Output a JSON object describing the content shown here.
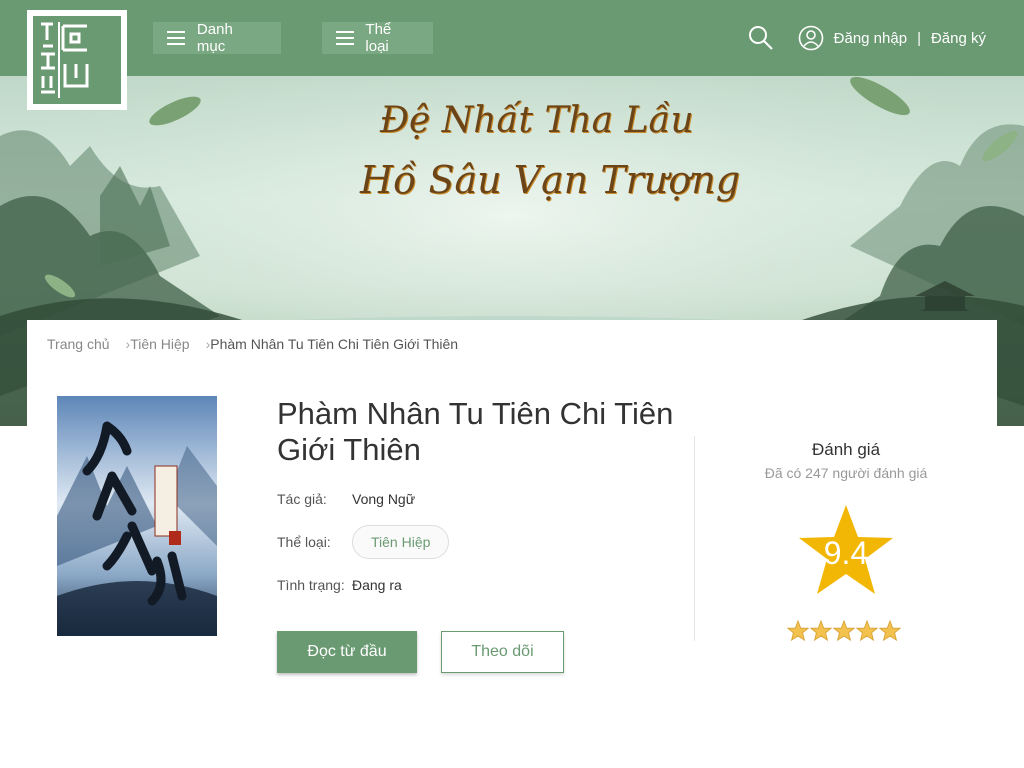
{
  "header": {
    "nav": [
      {
        "label": "Danh mục"
      },
      {
        "label": "Thể loại"
      }
    ],
    "login": "Đăng nhập",
    "separator": "|",
    "register": "Đăng ký"
  },
  "banner": {
    "title_line1": "Đệ Nhất Tha Lầu",
    "title_line2": "Hồ Sâu Vạn Trượng"
  },
  "breadcrumb": [
    "Trang chủ",
    "Tiên Hiệp",
    "Phàm Nhân Tu Tiên Chi Tiên Giới Thiên"
  ],
  "book": {
    "title": "Phàm Nhân Tu Tiên Chi Tiên Giới Thiên",
    "author_label": "Tác giả:",
    "author": "Vong Ngữ",
    "genre_label": "Thể loại:",
    "genre": "Tiên Hiệp",
    "status_label": "Tình trạng:",
    "status": "Đang ra"
  },
  "actions": {
    "read": "Đọc từ đầu",
    "follow": "Theo dõi"
  },
  "rating": {
    "title": "Đánh giá",
    "count_text": "Đã có 247 người đánh giá",
    "score": "9.4",
    "stars": 5
  },
  "colors": {
    "primary": "#6a9a72",
    "star": "#f2b705"
  }
}
